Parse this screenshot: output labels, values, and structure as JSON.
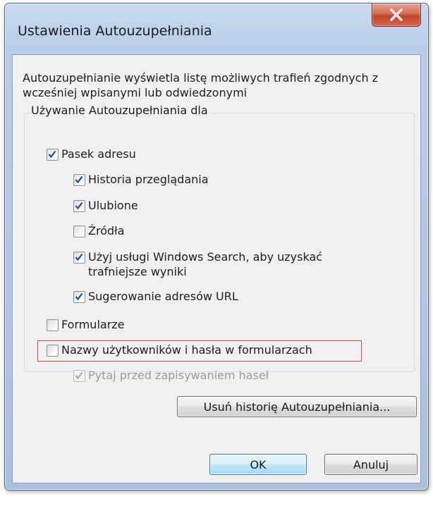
{
  "window": {
    "title": "Ustawienia Autouzupełniania",
    "close_label": "X"
  },
  "description": "Autouzupełnianie wyświetla listę możliwych trafień zgodnych z wcześniej wpisanymi lub odwiedzonymi",
  "group": {
    "label": "Używanie Autouzupełniania dla"
  },
  "options": {
    "address_bar": {
      "label": "Pasek adresu",
      "checked": true,
      "enabled": true
    },
    "browsing_history": {
      "label": "Historia przeglądania",
      "checked": true,
      "enabled": true
    },
    "favorites": {
      "label": "Ulubione",
      "checked": true,
      "enabled": true
    },
    "feeds": {
      "label": "Źródła",
      "checked": false,
      "enabled": true
    },
    "windows_search": {
      "label_line1": "Użyj usługi Windows Search, aby uzyskać",
      "label_line2": "trafniejsze wyniki",
      "checked": true,
      "enabled": true
    },
    "suggest_urls": {
      "label": "Sugerowanie adresów URL",
      "checked": true,
      "enabled": true
    },
    "forms": {
      "label": "Formularze",
      "checked": false,
      "enabled": true
    },
    "usernames_passwords": {
      "label": "Nazwy użytkowników i hasła w formularzach",
      "checked": false,
      "enabled": true
    },
    "ask_before_saving": {
      "label": "Pytaj przed zapisywaniem haseł",
      "checked": true,
      "enabled": false
    }
  },
  "buttons": {
    "delete_history": "Usuń historię Autouzupełniania...",
    "ok": "OK",
    "cancel": "Anuluj"
  },
  "colors": {
    "highlight_border": "#d94444",
    "check_mark": "#1f4e8c",
    "check_mark_disabled": "#a9a9a9"
  }
}
